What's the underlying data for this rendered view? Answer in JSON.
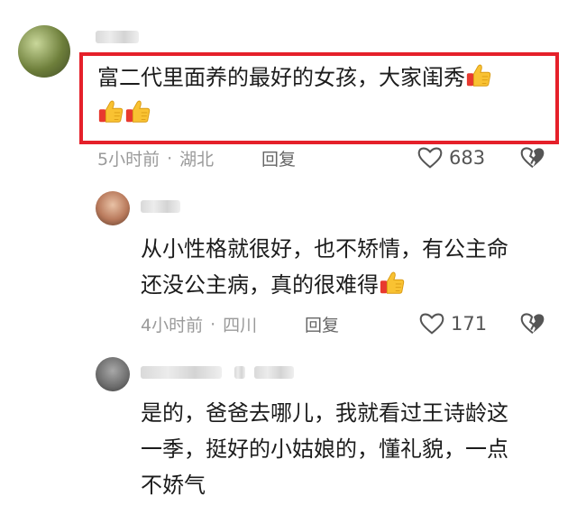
{
  "comments": [
    {
      "text_line1": "富二代里面养的最好的女孩，大家闺秀",
      "time": "5小时前",
      "location": "湖北",
      "reply_label": "回复",
      "likes": "683"
    },
    {
      "text_line1": "从小性格就很好，也不矫情，有公主命",
      "text_line2": "还没公主病，真的很难得",
      "time": "4小时前",
      "location": "四川",
      "reply_label": "回复",
      "likes": "171"
    },
    {
      "text_line1": "是的，爸爸去哪儿，我就看过王诗龄这",
      "text_line2": "一季，挺好的小姑娘的，懂礼貌，一点",
      "text_line3": "不娇气"
    }
  ],
  "icons": {
    "like": "heart-outline-icon",
    "dislike": "broken-heart-icon",
    "emoji": "thumbs-up-emoji"
  },
  "colors": {
    "highlight": "#e5202a",
    "meta_text": "#9a9a9a",
    "body_text": "#1c1c1c"
  }
}
